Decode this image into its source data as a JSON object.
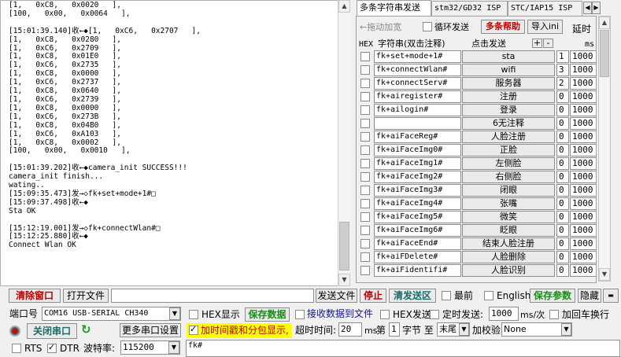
{
  "receive": {
    "lines": [
      "[1,   0xC8,   0x0020   ],",
      "[100,   0x00,   0x0064   ],",
      "",
      "[15:01:39.140]收←◆[1,   0xC6,   0x2707   ],",
      "[1,   0xC8,   0x0280   ],",
      "[1,   0xC6,   0x2709   ],",
      "[1,   0xC8,   0x01E0   ],",
      "[1,   0xC6,   0x2735   ],",
      "[1,   0xC8,   0x0000   ],",
      "[1,   0xC6,   0x2737   ],",
      "[1,   0xC8,   0x0640   ],",
      "[1,   0xC6,   0x2739   ],",
      "[1,   0xC8,   0x0000   ],",
      "[1,   0xC6,   0x273B   ],",
      "[1,   0xC8,   0x04B0   ],",
      "[1,   0xC6,   0xA103   ],",
      "[1,   0xC8,   0x0002   ],",
      "[100,   0x00,   0x0010   ],",
      "",
      "[15:01:39.202]收←◆camera_init SUCCESS!!!",
      "camera_init finish...",
      "wating..",
      "[15:09:35.473]发→◇fk+set+mode+1#□",
      "[15:09:37.498]收←◆",
      "Sta OK",
      "",
      "[15:12:19.001]发→◇fk+connectWlan#□",
      "[15:12:25.880]收←◆",
      "Connect Wlan OK"
    ]
  },
  "tabs": [
    "多条字符串发送",
    "stm32/GD32 ISP",
    "STC/IAP15 ISP"
  ],
  "multi": {
    "drag_label": "←拖动加宽",
    "loop_label": "循环发送",
    "help_button": "多条帮助",
    "import_button": "导入ini",
    "delay_label": "延时",
    "hex_header": "HEX",
    "str_header": "字符串(双击注释)",
    "send_header": "点击发送",
    "plus": "+",
    "minus": "-",
    "ms_header": "ms",
    "rows": [
      {
        "cmd": "fk+set+mode+1#",
        "label": "sta",
        "idx": "1",
        "ms": "1000"
      },
      {
        "cmd": "fk+connectWlan#",
        "label": "wifi",
        "idx": "3",
        "ms": "1000"
      },
      {
        "cmd": "fk+connectServ#",
        "label": "服务器",
        "idx": "2",
        "ms": "1000"
      },
      {
        "cmd": "fk+airegister#",
        "label": "注册",
        "idx": "0",
        "ms": "1000"
      },
      {
        "cmd": "fk+ailogin#",
        "label": "登录",
        "idx": "0",
        "ms": "1000"
      },
      {
        "cmd": "",
        "label": "6无注释",
        "idx": "0",
        "ms": "1000"
      },
      {
        "cmd": "fk+aiFaceReg#",
        "label": "人脸注册",
        "idx": "0",
        "ms": "1000"
      },
      {
        "cmd": "fk+aiFaceImg0#",
        "label": "正脸",
        "idx": "0",
        "ms": "1000"
      },
      {
        "cmd": "fk+aiFaceImg1#",
        "label": "左侧脸",
        "idx": "0",
        "ms": "1000"
      },
      {
        "cmd": "fk+aiFaceImg2#",
        "label": "右侧脸",
        "idx": "0",
        "ms": "1000"
      },
      {
        "cmd": "fk+aiFaceImg3#",
        "label": "闭眼",
        "idx": "0",
        "ms": "1000"
      },
      {
        "cmd": "fk+aiFaceImg4#",
        "label": "张嘴",
        "idx": "0",
        "ms": "1000"
      },
      {
        "cmd": "fk+aiFaceImg5#",
        "label": "微笑",
        "idx": "0",
        "ms": "1000"
      },
      {
        "cmd": "fk+aiFaceImg6#",
        "label": "眨眼",
        "idx": "0",
        "ms": "1000"
      },
      {
        "cmd": "fk+aiFaceEnd#",
        "label": "结束人脸注册",
        "idx": "0",
        "ms": "1000"
      },
      {
        "cmd": "fk+aiFDelete#",
        "label": "人脸删除",
        "idx": "0",
        "ms": "1000"
      },
      {
        "cmd": "fk+aiFidentifi#",
        "label": "人脸识别",
        "idx": "0",
        "ms": "1000"
      }
    ]
  },
  "toolbar": {
    "clear_window": "清除窗口",
    "open_file": "打开文件",
    "send_file": "发送文件",
    "stop": "停止",
    "clear_send": "清发送区",
    "topmost": "最前",
    "english": "English",
    "save_params": "保存参数",
    "hide": "隐藏"
  },
  "port": {
    "port_label": "端口号",
    "port_value": "COM16 USB-SERIAL CH340",
    "close_port": "关闭串口",
    "more_settings": "更多串口设置",
    "rts": "RTS",
    "dtr": "DTR",
    "baud_label": "波特率:",
    "baud_value": "115200"
  },
  "options": {
    "hex_display": "HEX显示",
    "save_data": "保存数据",
    "recv_to_file": "接收数据到文件",
    "hex_send": "HEX发送",
    "timed_send": "定时发送:",
    "timed_value": "1000",
    "ms_per": "ms/次",
    "add_crlf": "加回车换行",
    "timestamp": "加时间戳和分包显示,",
    "timeout_label": "超时时间:",
    "timeout_value": "20",
    "ms": "ms",
    "nth": "第",
    "nth_value": "1",
    "byte_to": "字节 至",
    "end_value": "末尾",
    "checksum_label": "加校验",
    "checksum_value": "None"
  },
  "send_text": "fk#"
}
